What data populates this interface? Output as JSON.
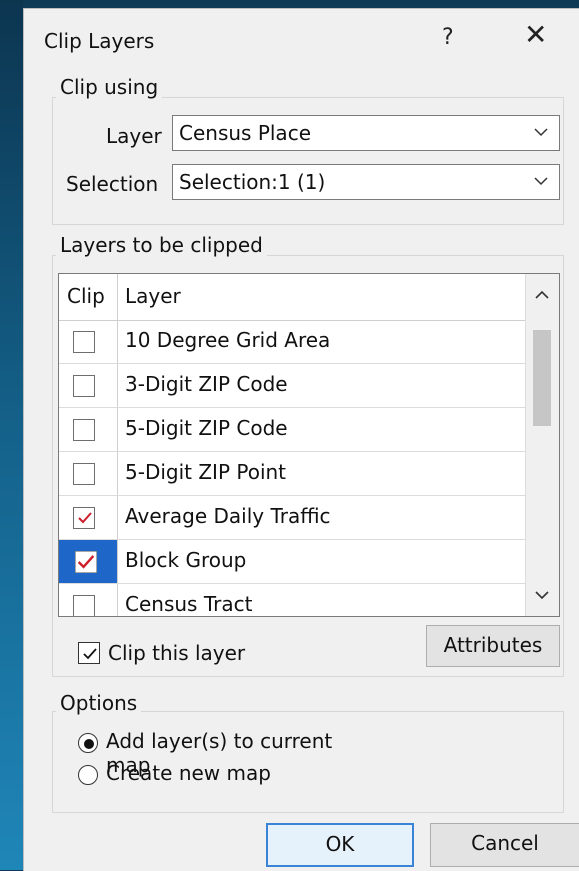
{
  "dialog": {
    "title": "Clip Layers",
    "help_glyph": "?",
    "close_glyph": "✕"
  },
  "clip_using": {
    "legend": "Clip using",
    "layer_label": "Layer",
    "layer_value": "Census Place",
    "selection_label": "Selection",
    "selection_value": "Selection:1 (1)"
  },
  "layers_to_clip": {
    "legend": "Layers to be clipped",
    "columns": [
      "Clip",
      "Layer"
    ],
    "rows": [
      {
        "layer": "10 Degree Grid Area",
        "checked": false,
        "selected": false
      },
      {
        "layer": "3-Digit ZIP Code",
        "checked": false,
        "selected": false
      },
      {
        "layer": "5-Digit ZIP Code",
        "checked": false,
        "selected": false
      },
      {
        "layer": "5-Digit ZIP Point",
        "checked": false,
        "selected": false
      },
      {
        "layer": "Average Daily Traffic",
        "checked": true,
        "selected": false
      },
      {
        "layer": "Block Group",
        "checked": true,
        "selected": true
      },
      {
        "layer": "Census Tract",
        "checked": false,
        "selected": false
      }
    ]
  },
  "clip_this_layer": {
    "label": "Clip this layer",
    "checked": true
  },
  "attributes_button": "Attributes",
  "options": {
    "legend": "Options",
    "add_to_current": "Add layer(s) to current map",
    "create_new": "Create new map",
    "selected": "add_to_current"
  },
  "buttons": {
    "ok": "OK",
    "cancel": "Cancel"
  },
  "colors": {
    "selection_blue": "#1f66c9",
    "check_red": "#cc1f2b"
  }
}
